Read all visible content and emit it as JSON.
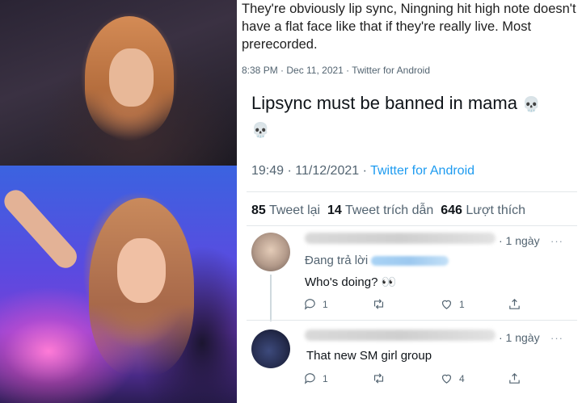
{
  "quoted_tweet": {
    "text": "They're obviously lip sync, Ningning hit high note doesn't have a flat face like that if they're really live. Most prerecorded.",
    "timestamp": "8:38 PM · Dec 11, 2021 · Twitter for Android"
  },
  "main_tweet": {
    "text": "Lipsync must be banned in mama",
    "emoji_1": "💀",
    "emoji_2": "💀",
    "time": "19:49 · 11/12/2021 · ",
    "source": "Twitter for Android"
  },
  "stats": {
    "retweets_count": "85",
    "retweets_label": "Tweet lại",
    "quotes_count": "14",
    "quotes_label": "Tweet trích dẫn",
    "likes_count": "646",
    "likes_label": "Lượt thích"
  },
  "replies": [
    {
      "time": "· 1 ngày",
      "more": "···",
      "replying_label": "Đang trả lời",
      "text": "Who's doing?",
      "emoji": "👀",
      "reply_count": "1",
      "retweet_count": "",
      "like_count": "1"
    },
    {
      "time": "· 1 ngày",
      "more": "···",
      "text": "That new SM girl group",
      "reply_count": "1",
      "retweet_count": "",
      "like_count": "4"
    }
  ],
  "icons": {
    "reply": "reply-bubble-icon",
    "retweet": "retweet-arrows-icon",
    "like": "heart-icon",
    "share": "share-upload-icon",
    "more": "more-dots-icon"
  },
  "colors": {
    "link_blue": "#1d9bf0",
    "secondary_text": "#536471"
  }
}
